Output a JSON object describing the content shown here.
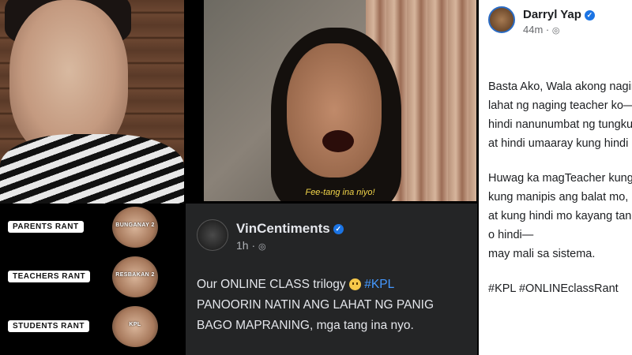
{
  "photo_middle": {
    "caption": "Fee-tang ina niyo!"
  },
  "rants": [
    {
      "label": "PARENTS RANT",
      "thumb_text": "BUNGANAY 2"
    },
    {
      "label": "TEACHERS RANT",
      "thumb_text": "RESBAKAN 2"
    },
    {
      "label": "STUDENTS RANT",
      "thumb_text": "KPL"
    }
  ],
  "post_mid": {
    "author": "VinCentiments",
    "time": "1h ·",
    "line1": "Our ONLINE CLASS trilogy",
    "hashtag": "#KPL",
    "line2": "PANOORIN NATIN ANG LAHAT NG PANIG",
    "line3": "BAGO MAPRANING, mga tang ina nyo."
  },
  "post_right": {
    "author": "Darryl Yap",
    "time": "44m ·",
    "para1": [
      "Basta Ako, Wala akong naging Te",
      "lahat ng naging teacher ko—matil",
      "hindi nanunumbat ng tungkulin at",
      "at hindi umaaray kung hindi natat"
    ],
    "para2": [
      "Huwag ka magTeacher kung mak",
      "kung manipis ang balat mo,",
      "at kung hindi mo kayang tanggap",
      "o hindi—",
      "may mali sa sistema."
    ],
    "hashtags": "#KPL #ONLINEclassRant"
  },
  "colors": {
    "hashtag": "#4599ff",
    "caption": "#f3d64a",
    "verified": "#1b74e4"
  }
}
